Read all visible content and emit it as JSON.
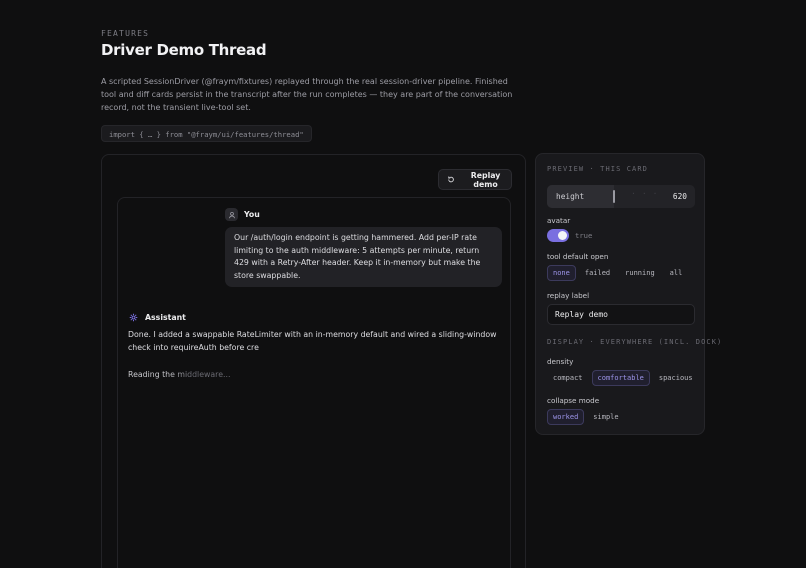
{
  "header": {
    "eyebrow": "FEATURES",
    "title": "Driver Demo Thread",
    "description": "A scripted SessionDriver (@fraym/fixtures) replayed through the real session-driver pipeline. Finished tool and diff cards persist in the transcript after the run completes — they are part of the conversation record, not the transient live-tool set.",
    "import_code": "import { … } from \"@fraym/ui/features/thread\""
  },
  "demo": {
    "replay_button": "Replay demo",
    "user": {
      "label": "You",
      "message": "Our /auth/login endpoint is getting hammered. Add per-IP rate limiting to the auth middleware: 5 attempts per minute, return 429 with a Retry-After header. Keep it in-memory but make the store swappable."
    },
    "assistant": {
      "label": "Assistant",
      "message": "Done. I added a swappable RateLimiter with an in-memory default and wired a sliding-window check into requireAuth before cre",
      "status": "Reading the middleware..."
    }
  },
  "side": {
    "preview_head": "PREVIEW · THIS CARD",
    "height": {
      "label": "height",
      "value": "620",
      "level": 0.45
    },
    "avatar": {
      "label": "avatar",
      "value": "true",
      "on": true
    },
    "tool_default_open": {
      "label": "tool default open",
      "options": [
        "none",
        "failed",
        "running",
        "all"
      ],
      "selected": "none"
    },
    "replay_label": {
      "label": "replay label",
      "value": "Replay demo"
    },
    "display_head": "DISPLAY · EVERYWHERE (INCL. DOCK)",
    "density": {
      "label": "density",
      "options": [
        "compact",
        "comfortable",
        "spacious"
      ],
      "selected": "comfortable"
    },
    "collapse_mode": {
      "label": "collapse mode",
      "options": [
        "worked",
        "simple"
      ],
      "selected": "worked"
    }
  },
  "colors": {
    "accent": "#7a6fe0",
    "background": "#0f0f10",
    "panel": "#19191c"
  }
}
